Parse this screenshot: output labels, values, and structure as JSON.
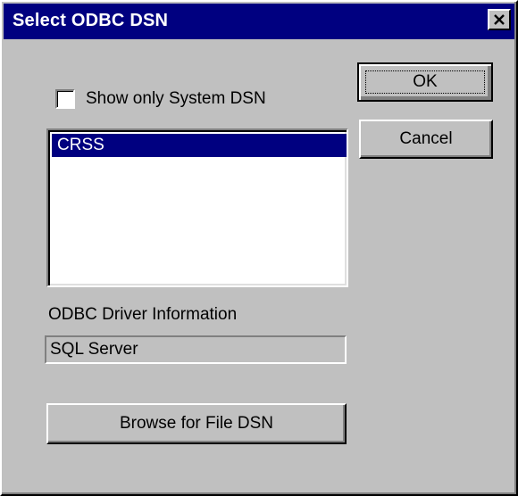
{
  "window": {
    "title": "Select ODBC DSN"
  },
  "options": {
    "system_dsn_checkbox_label": "Show only System DSN",
    "system_dsn_checked": false
  },
  "dsn_list": {
    "items": [
      {
        "label": "CRSS",
        "selected": true
      }
    ]
  },
  "driver_info": {
    "label": "ODBC Driver Information",
    "value": "SQL Server"
  },
  "buttons": {
    "ok_label": "OK",
    "cancel_label": "Cancel",
    "browse_label": "Browse for File DSN"
  },
  "colors": {
    "titlebar": "#000080",
    "selection": "#000080",
    "face": "#c0c0c0"
  }
}
